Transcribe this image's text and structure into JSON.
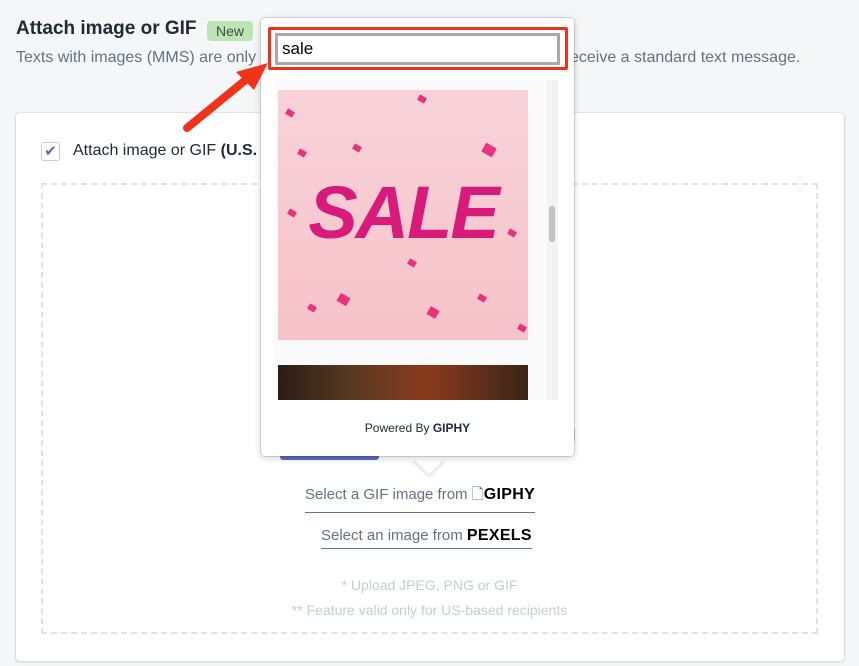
{
  "header": {
    "title": "Attach image or GIF",
    "badge": "New",
    "description": "Texts with images (MMS) are only supported in the U.S. Other customers will receive a standard text message."
  },
  "card": {
    "checkbox_label": "Attach image or GIF",
    "checkbox_label_bold": "(U.S.",
    "checked": true,
    "behind_text": "d",
    "giphy_link": "Select a GIF image from",
    "giphy_brand": "GIPHY",
    "pexels_link": "Select an image from",
    "pexels_brand": "PEXELS",
    "note1": "* Upload JPEG, PNG or GIF",
    "note2": "** Feature valid only for US-based recipients"
  },
  "popup": {
    "search_value": "sale",
    "gif1_text": "SALE",
    "powered_by": "Powered By",
    "powered_brand": "GIPHY"
  },
  "colors": {
    "accent": "#5c6ac4",
    "highlight": "#f0321b",
    "badge": "#bbe5b3",
    "sale": "#d81b7a"
  }
}
